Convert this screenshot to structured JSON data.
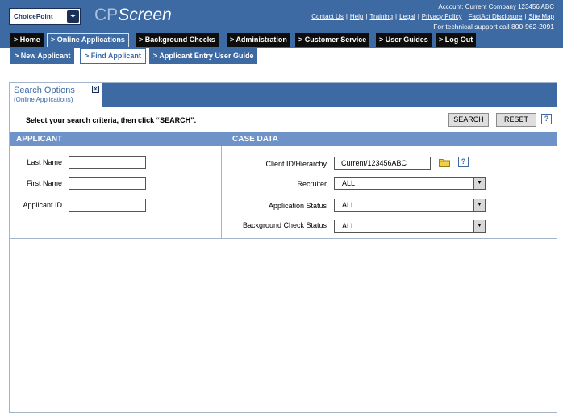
{
  "header": {
    "logo_text": "ChoicePoint",
    "brand_prefix": "CP",
    "brand_suffix": "Screen",
    "account": "Account: Current Company 123456 ABC",
    "links": [
      "Contact Us",
      "Help",
      "Training",
      "Legal",
      "Privacy Policy",
      "FactAct Disclosure",
      "Site Map"
    ],
    "support": "For technical support call 800-962-2091"
  },
  "nav": {
    "main": [
      "> Home",
      "> Online Applications",
      "> Background Checks",
      "> Administration",
      "> Customer Service",
      "> User Guides",
      "> Log Out"
    ],
    "selected_main": "> Online Applications",
    "sub": [
      "> New Applicant",
      "> Find Applicant",
      "> Applicant Entry User Guide"
    ],
    "selected_sub": "> Find Applicant"
  },
  "panel": {
    "tab_title": "Search Options",
    "tab_subtitle": "(Online Applications)",
    "close_glyph": "x",
    "instruction": "Select your search criteria, then click “SEARCH”.",
    "search_label": "SEARCH",
    "reset_label": "RESET",
    "help_glyph": "?"
  },
  "applicant": {
    "heading": "APPLICANT",
    "last_name_label": "Last Name",
    "last_name_value": "",
    "first_name_label": "First Name",
    "first_name_value": "",
    "applicant_id_label": "Applicant ID",
    "applicant_id_value": ""
  },
  "case_data": {
    "heading": "CASE DATA",
    "client_label": "Client ID/Hierarchy",
    "client_value": "Current/123456ABC",
    "recruiter_label": "Recruiter",
    "recruiter_value": "ALL",
    "app_status_label": "Application Status",
    "app_status_value": "ALL",
    "bg_status_label": "Background Check Status",
    "bg_status_value": "ALL"
  },
  "icons": {
    "folder": "folder-icon",
    "help": "help-icon",
    "dropdown": "chevron-down-icon",
    "close": "close-icon",
    "logo": "choicepoint-logo"
  },
  "colors": {
    "header_blue": "#3e6aa4",
    "section_blue": "#6e93c9",
    "nav_black": "#0d0d0d"
  }
}
